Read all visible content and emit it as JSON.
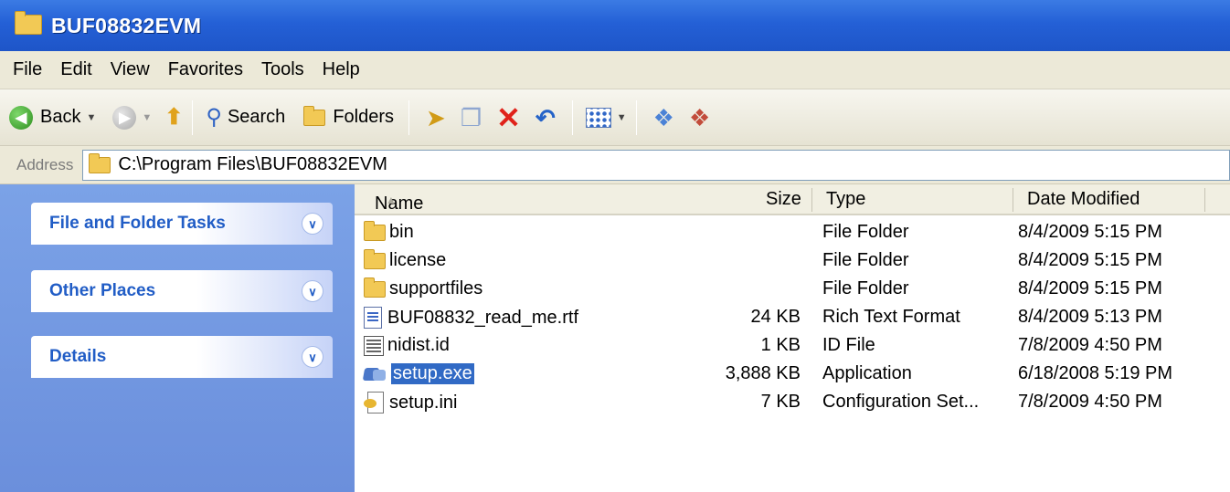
{
  "window": {
    "title": "BUF08832EVM"
  },
  "menu": [
    "File",
    "Edit",
    "View",
    "Favorites",
    "Tools",
    "Help"
  ],
  "toolbar": {
    "back_label": "Back",
    "search_label": "Search",
    "folders_label": "Folders"
  },
  "address": {
    "label": "Address",
    "path": "C:\\Program Files\\BUF08832EVM"
  },
  "taskpane": {
    "panels": [
      {
        "title": "File and Folder Tasks"
      },
      {
        "title": "Other Places"
      },
      {
        "title": "Details"
      }
    ]
  },
  "columns": {
    "name": "Name",
    "size": "Size",
    "type": "Type",
    "date": "Date Modified"
  },
  "files": [
    {
      "name": "bin",
      "size": "",
      "type": "File Folder",
      "date": "8/4/2009 5:15 PM",
      "icon": "folder-icon"
    },
    {
      "name": "license",
      "size": "",
      "type": "File Folder",
      "date": "8/4/2009 5:15 PM",
      "icon": "folder-icon"
    },
    {
      "name": "supportfiles",
      "size": "",
      "type": "File Folder",
      "date": "8/4/2009 5:15 PM",
      "icon": "folder-icon"
    },
    {
      "name": "BUF08832_read_me.rtf",
      "size": "24 KB",
      "type": "Rich Text Format",
      "date": "8/4/2009 5:13 PM",
      "icon": "rtf-file-icon"
    },
    {
      "name": "nidist.id",
      "size": "1 KB",
      "type": "ID File",
      "date": "7/8/2009 4:50 PM",
      "icon": "id-file-icon"
    },
    {
      "name": "setup.exe",
      "size": "3,888 KB",
      "type": "Application",
      "date": "6/18/2008 5:19 PM",
      "icon": "exe-file-icon",
      "selected": true
    },
    {
      "name": "setup.ini",
      "size": "7 KB",
      "type": "Configuration Set...",
      "date": "7/8/2009 4:50 PM",
      "icon": "ini-file-icon"
    }
  ],
  "colors": {
    "titlebar": "#2460d6",
    "taskpane": "#7ba2e7",
    "selection": "#316ac5"
  }
}
